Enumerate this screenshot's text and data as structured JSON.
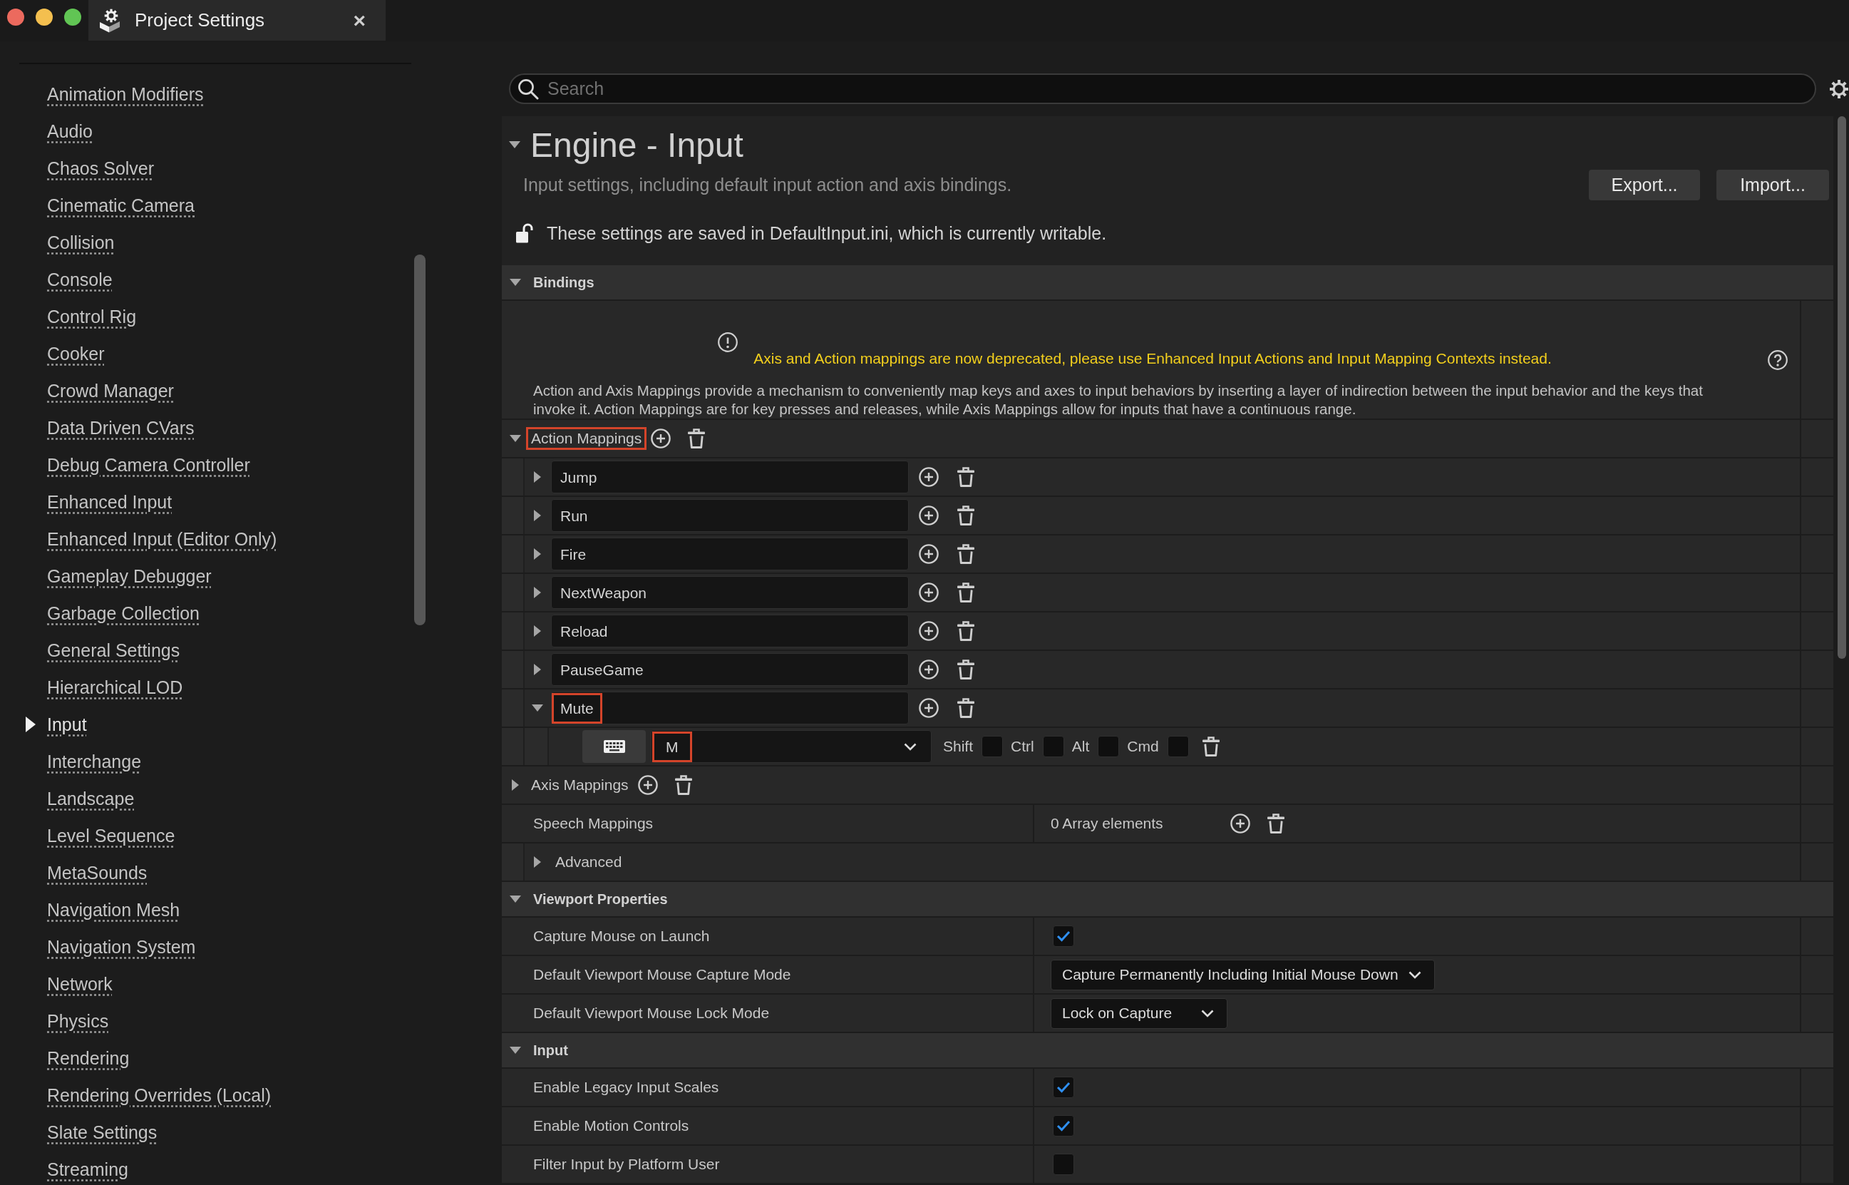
{
  "window": {
    "tab": {
      "title": "Project Settings",
      "close": "×"
    }
  },
  "sidebar": {
    "items": [
      {
        "label": "Animation Modifiers",
        "selected": false
      },
      {
        "label": "Audio",
        "selected": false
      },
      {
        "label": "Chaos Solver",
        "selected": false
      },
      {
        "label": "Cinematic Camera",
        "selected": false
      },
      {
        "label": "Collision",
        "selected": false
      },
      {
        "label": "Console",
        "selected": false
      },
      {
        "label": "Control Rig",
        "selected": false
      },
      {
        "label": "Cooker",
        "selected": false
      },
      {
        "label": "Crowd Manager",
        "selected": false
      },
      {
        "label": "Data Driven CVars",
        "selected": false
      },
      {
        "label": "Debug Camera Controller",
        "selected": false
      },
      {
        "label": "Enhanced Input",
        "selected": false
      },
      {
        "label": "Enhanced Input (Editor Only)",
        "selected": false
      },
      {
        "label": "Gameplay Debugger",
        "selected": false
      },
      {
        "label": "Garbage Collection",
        "selected": false
      },
      {
        "label": "General Settings",
        "selected": false
      },
      {
        "label": "Hierarchical LOD",
        "selected": false
      },
      {
        "label": "Input",
        "selected": true
      },
      {
        "label": "Interchange",
        "selected": false
      },
      {
        "label": "Landscape",
        "selected": false
      },
      {
        "label": "Level Sequence",
        "selected": false
      },
      {
        "label": "MetaSounds",
        "selected": false
      },
      {
        "label": "Navigation Mesh",
        "selected": false
      },
      {
        "label": "Navigation System",
        "selected": false
      },
      {
        "label": "Network",
        "selected": false
      },
      {
        "label": "Physics",
        "selected": false
      },
      {
        "label": "Rendering",
        "selected": false
      },
      {
        "label": "Rendering Overrides (Local)",
        "selected": false
      },
      {
        "label": "Slate Settings",
        "selected": false
      },
      {
        "label": "Streaming",
        "selected": false
      }
    ]
  },
  "search": {
    "placeholder": "Search"
  },
  "header": {
    "title": "Engine - Input",
    "expanded": true,
    "description": "Input settings, including default input action and axis bindings.",
    "buttons": [
      "Export...",
      "Import..."
    ],
    "config_note": "These settings are saved in DefaultInput.ini, which is currently writable."
  },
  "sections": [
    {
      "title": "Bindings",
      "expanded": true,
      "rows": [
        {
          "kind": "notice",
          "warning": "Axis and Action mappings are now deprecated, please use Enhanced Input Actions and Input Mapping Contexts instead.",
          "text": "Action and Axis Mappings provide a mechanism to conveniently map keys and axes to input behaviors by inserting a layer of indirection between the input behavior and the keys that invoke it. Action Mappings are for key presses and releases, while Axis Mappings allow for inputs that have a continuous range."
        },
        {
          "kind": "mappings",
          "label": "Action Mappings",
          "expanded": true,
          "highlighted": true,
          "items": [
            {
              "name": "Jump",
              "expanded": false,
              "highlighted": false
            },
            {
              "name": "Run",
              "expanded": false,
              "highlighted": false
            },
            {
              "name": "Fire",
              "expanded": false,
              "highlighted": false
            },
            {
              "name": "NextWeapon",
              "expanded": false,
              "highlighted": false
            },
            {
              "name": "Reload",
              "expanded": false,
              "highlighted": false
            },
            {
              "name": "PauseGame",
              "expanded": false,
              "highlighted": false
            },
            {
              "name": "Mute",
              "expanded": true,
              "highlighted": true,
              "keys": [
                {
                  "key": "M",
                  "highlighted": true,
                  "modifiers": [
                    {
                      "label": "Shift",
                      "checked": false
                    },
                    {
                      "label": "Ctrl",
                      "checked": false
                    },
                    {
                      "label": "Alt",
                      "checked": false
                    },
                    {
                      "label": "Cmd",
                      "checked": false
                    }
                  ]
                }
              ]
            }
          ]
        },
        {
          "kind": "mappings",
          "label": "Axis Mappings",
          "expanded": false,
          "highlighted": false
        },
        {
          "kind": "array",
          "label": "Speech Mappings",
          "value": "0 Array elements"
        },
        {
          "kind": "group",
          "label": "Advanced",
          "expanded": false
        }
      ]
    },
    {
      "title": "Viewport Properties",
      "expanded": true,
      "rows": [
        {
          "kind": "checkbox",
          "label": "Capture Mouse on Launch",
          "checked": true
        },
        {
          "kind": "dropdown",
          "label": "Default Viewport Mouse Capture Mode",
          "value": "Capture Permanently Including Initial Mouse Down"
        },
        {
          "kind": "dropdown",
          "label": "Default Viewport Mouse Lock Mode",
          "value": "Lock on Capture"
        }
      ]
    },
    {
      "title": "Input",
      "expanded": true,
      "rows": [
        {
          "kind": "checkbox",
          "label": "Enable Legacy Input Scales",
          "checked": true
        },
        {
          "kind": "checkbox",
          "label": "Enable Motion Controls",
          "checked": true
        },
        {
          "kind": "checkbox",
          "label": "Filter Input by Platform User",
          "checked": false
        }
      ]
    }
  ]
}
